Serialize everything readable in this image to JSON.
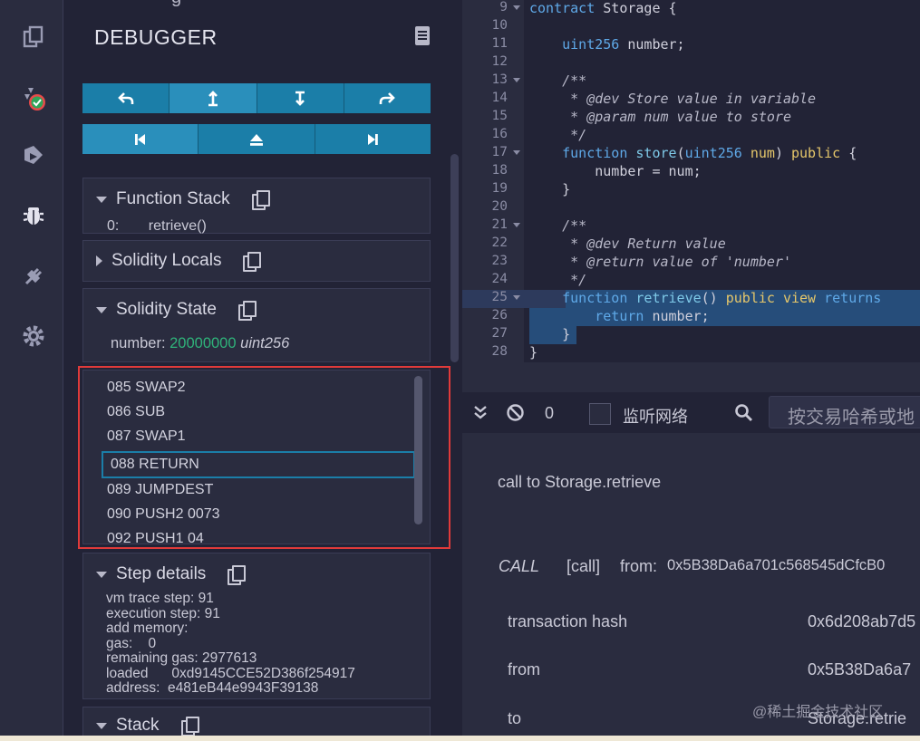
{
  "sidebar": {
    "icons": [
      "file-explorer-icon",
      "solidity-compiler-icon",
      "deploy-run-icon",
      "debugger-icon",
      "plugin-manager-icon",
      "settings-icon"
    ]
  },
  "debugger": {
    "title": "DEBUGGER",
    "title_fragment": "g"
  },
  "function_stack": {
    "label": "Function Stack",
    "entry_index": "0:",
    "entry_value": "retrieve()"
  },
  "solidity_locals": {
    "label": "Solidity Locals"
  },
  "solidity_state": {
    "label": "Solidity State",
    "var_name": "number:",
    "var_value": "20000000",
    "var_type": "uint256"
  },
  "opcodes": [
    "085 SWAP2",
    "086 SUB",
    "087 SWAP1",
    "088 RETURN",
    "089 JUMPDEST",
    "090 PUSH2 0073",
    "092 PUSH1 04"
  ],
  "step_details": {
    "label": "Step details",
    "lines": [
      "vm trace step: 91",
      "execution step: 91",
      "add memory:",
      "gas:    0",
      "remaining gas: 2977613",
      "loaded      0xd9145CCE52D386f254917",
      "address:  e481eB44e9943F39138"
    ]
  },
  "stack": {
    "label": "Stack"
  },
  "editor": {
    "line_numbers": [
      "9",
      "10",
      "11",
      "12",
      "13",
      "14",
      "15",
      "16",
      "17",
      "18",
      "19",
      "20",
      "21",
      "22",
      "23",
      "24",
      "25",
      "26",
      "27",
      "28"
    ]
  },
  "terminal": {
    "count": "0",
    "listen_label": "监听网络",
    "search_placeholder": "按交易哈希或地",
    "call_title": "call to Storage.retrieve",
    "call_type": "CALL",
    "call_kind": "[call]",
    "from_label": "from:",
    "from_value": "0x5B38Da6a701c568545dCfcB0",
    "tx_hash_label": "transaction hash",
    "tx_hash_value": "0x6d208ab7d5",
    "from_row_label": "from",
    "from_row_value": "0x5B38Da6a7",
    "to_label": "to",
    "to_value": "Storage.retrie"
  },
  "watermark": "@稀土掘金技术社区",
  "colors": {
    "accent": "#1b7ea8",
    "highlight_box": "#e03a3a",
    "state_value": "#2fb37a"
  }
}
